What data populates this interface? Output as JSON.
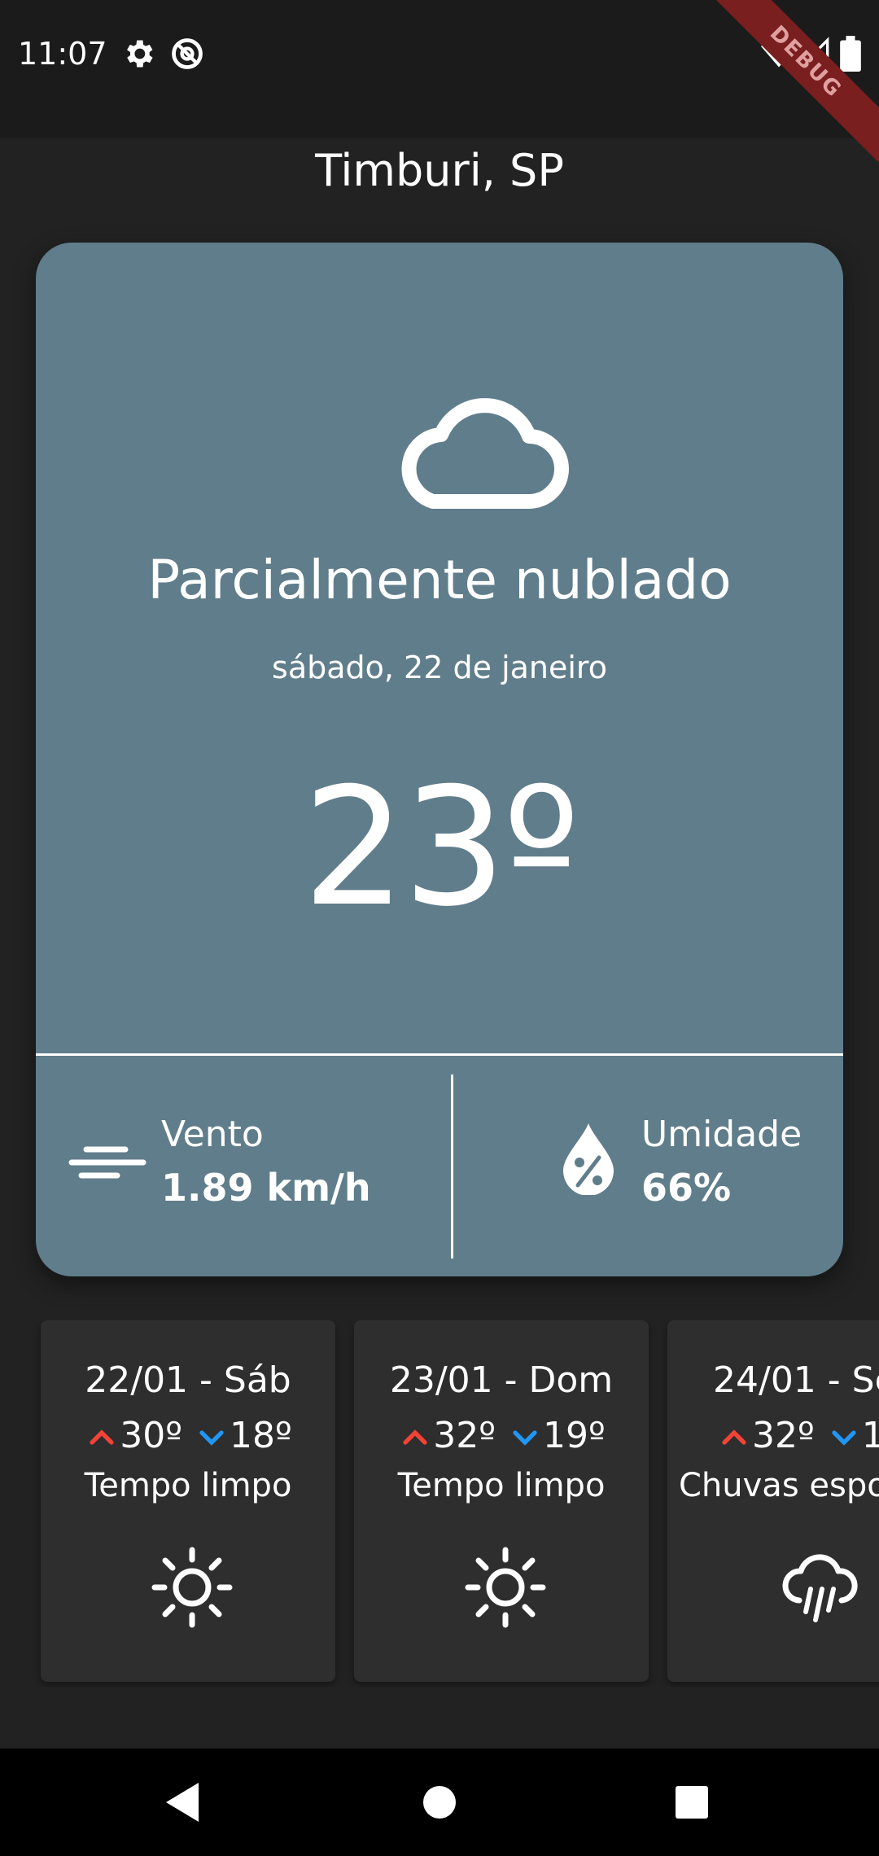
{
  "status_bar": {
    "time": "11:07",
    "icons": [
      "gear-icon",
      "at-sign-icon",
      "wifi-icon",
      "cellular-signal-icon",
      "battery-icon"
    ],
    "debug_banner": "DEBUG"
  },
  "location": "Timburi, SP",
  "current": {
    "icon": "cloud-icon",
    "condition": "Parcialmente nublado",
    "date": "sábado, 22 de janeiro",
    "temperature": "23º",
    "wind": {
      "label": "Vento",
      "value": "1.89 km/h",
      "icon": "wind-icon"
    },
    "humidity": {
      "label": "Umidade",
      "value": "66%",
      "icon": "humidity-drop-icon"
    }
  },
  "forecast": [
    {
      "title": "22/01 - Sáb",
      "max": "30º",
      "min": "18º",
      "description": "Tempo limpo",
      "icon": "sun-icon"
    },
    {
      "title": "23/01 - Dom",
      "max": "32º",
      "min": "19º",
      "description": "Tempo limpo",
      "icon": "sun-icon"
    },
    {
      "title": "24/01 - Se",
      "max": "32º",
      "min": "1",
      "description": "Chuvas espo",
      "icon": "rain-cloud-icon"
    }
  ],
  "colors": {
    "background": "#222222",
    "card": "#607d8b",
    "forecast_card": "#2e2e2e",
    "max_arrow": "#f44336",
    "min_arrow": "#2196f3",
    "debug_ribbon": "#7a1f1f"
  },
  "nav_bar": {
    "icons": [
      "back-triangle-icon",
      "home-circle-icon",
      "recents-square-icon"
    ]
  }
}
